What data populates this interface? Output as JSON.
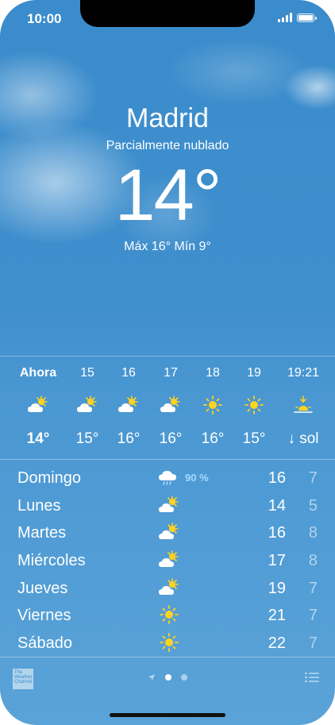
{
  "status_bar": {
    "time": "10:00"
  },
  "current": {
    "city": "Madrid",
    "condition": "Parcialmente nublado",
    "temperature": "14°",
    "hi_lo": "Máx 16° Mín 9°"
  },
  "hourly": [
    {
      "label": "Ahora",
      "icon": "partly-cloudy-icon",
      "temp": "14°",
      "bold": true
    },
    {
      "label": "15",
      "icon": "partly-cloudy-icon",
      "temp": "15°"
    },
    {
      "label": "16",
      "icon": "partly-cloudy-icon",
      "temp": "16°"
    },
    {
      "label": "17",
      "icon": "partly-cloudy-icon",
      "temp": "16°"
    },
    {
      "label": "18",
      "icon": "sun-icon",
      "temp": "16°"
    },
    {
      "label": "19",
      "icon": "sun-icon",
      "temp": "15°"
    },
    {
      "label": "19:21",
      "icon": "sunset-icon",
      "temp": "↓ sol"
    }
  ],
  "daily": [
    {
      "day": "Domingo",
      "icon": "rain-cloud-icon",
      "precip": "90 %",
      "high": "16",
      "low": "7"
    },
    {
      "day": "Lunes",
      "icon": "partly-cloudy-icon",
      "precip": "",
      "high": "14",
      "low": "5"
    },
    {
      "day": "Martes",
      "icon": "partly-cloudy-icon",
      "precip": "",
      "high": "16",
      "low": "8"
    },
    {
      "day": "Miércoles",
      "icon": "partly-cloudy-icon",
      "precip": "",
      "high": "17",
      "low": "8"
    },
    {
      "day": "Jueves",
      "icon": "partly-cloudy-icon",
      "precip": "",
      "high": "19",
      "low": "7"
    },
    {
      "day": "Viernes",
      "icon": "sun-icon",
      "precip": "",
      "high": "21",
      "low": "7"
    },
    {
      "day": "Sábado",
      "icon": "sun-icon",
      "precip": "",
      "high": "22",
      "low": "7"
    }
  ],
  "footer": {
    "logo_text": "The Weather Channel",
    "page_count": 2,
    "active_page": 0
  },
  "colors": {
    "sky": "#3f8fcd",
    "sun": "#ffd21f",
    "precip": "#a6dbff"
  }
}
